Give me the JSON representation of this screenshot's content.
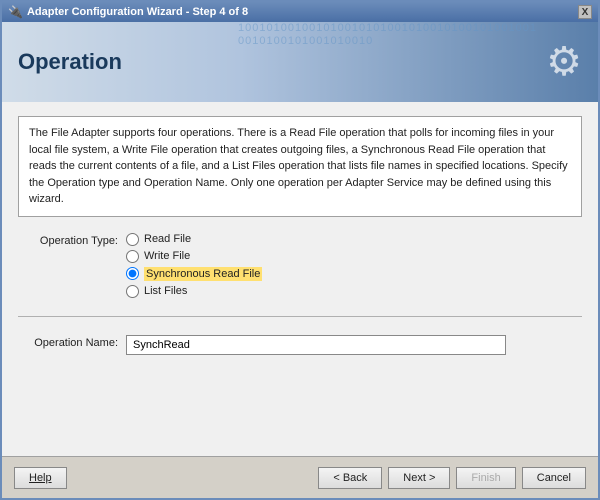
{
  "window": {
    "title": "Adapter Configuration Wizard - Step 4 of 8",
    "close_label": "X"
  },
  "header": {
    "title": "Operation",
    "bg_text": "1001010010010100101010010100101001010010010010100101001010010",
    "icon": "⚙"
  },
  "description": {
    "text": "The File Adapter supports four operations.  There is a Read File operation that polls for incoming files in your local file system, a Write File operation that creates outgoing files, a Synchronous Read File operation that reads the current contents of a file, and a List Files operation that lists file names in specified locations.  Specify the Operation type and Operation Name.  Only one operation per Adapter Service may be defined using this wizard."
  },
  "form": {
    "operation_type_label": "Operation Type:",
    "operation_name_label": "Operation Name:",
    "radio_options": [
      {
        "id": "read-file",
        "label": "Read File",
        "selected": false
      },
      {
        "id": "write-file",
        "label": "Write File",
        "selected": false
      },
      {
        "id": "sync-read",
        "label": "Synchronous Read File",
        "selected": true
      },
      {
        "id": "list-files",
        "label": "List Files",
        "selected": false
      }
    ],
    "operation_name_value": "SynchRead"
  },
  "buttons": {
    "help": "Help",
    "back": "< Back",
    "next": "Next >",
    "finish": "Finish",
    "cancel": "Cancel"
  }
}
